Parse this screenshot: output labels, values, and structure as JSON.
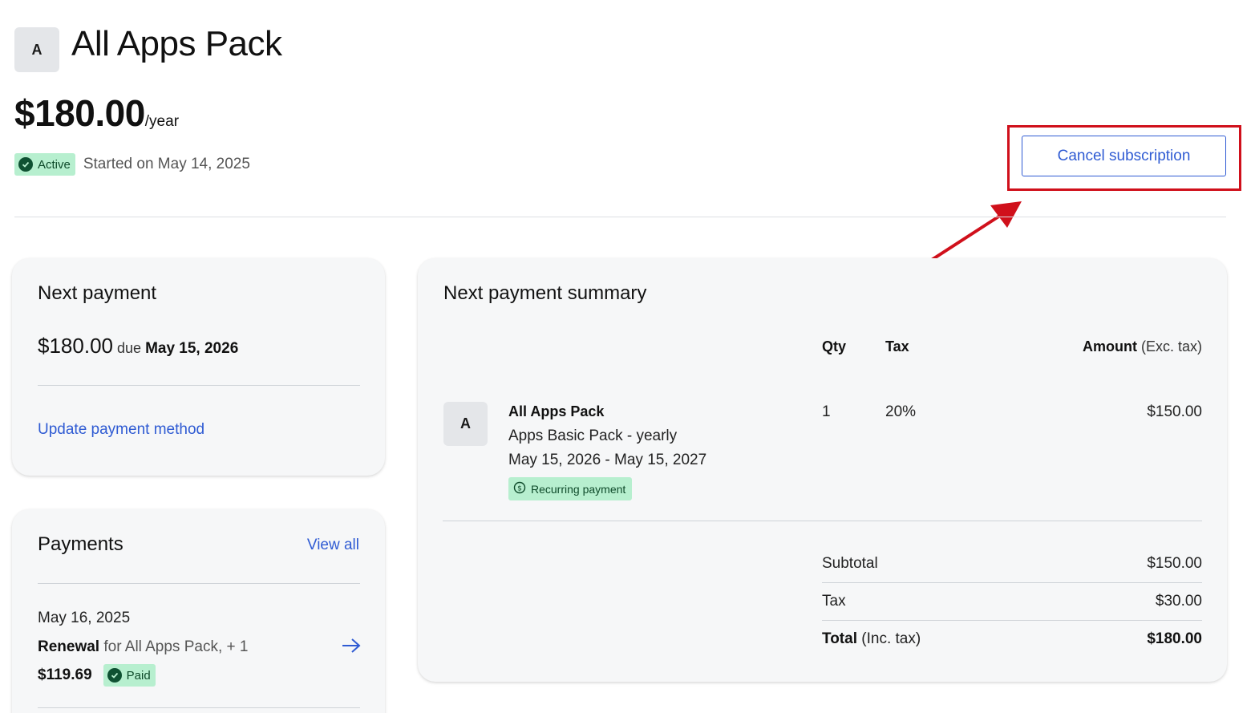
{
  "header": {
    "avatar_letter": "A",
    "title": "All Apps Pack",
    "price": "$180.00",
    "price_period": "/year",
    "status_badge": "Active",
    "started_text": "Started on May 14, 2025",
    "cancel_label": "Cancel subscription"
  },
  "next_payment": {
    "title": "Next payment",
    "amount": "$180.00",
    "due_word": "due",
    "due_date": "May 15, 2026",
    "update_link": "Update payment method"
  },
  "payments": {
    "title": "Payments",
    "view_all": "View all",
    "items": [
      {
        "date": "May 16, 2025",
        "type": "Renewal",
        "description": "for All Apps Pack, + 1",
        "amount": "$119.69",
        "status": "Paid"
      }
    ]
  },
  "summary": {
    "title": "Next payment summary",
    "columns": {
      "qty": "Qty",
      "tax": "Tax",
      "amount": "Amount",
      "amount_note": "(Exc. tax)"
    },
    "line_items": [
      {
        "avatar_letter": "A",
        "name": "All Apps Pack",
        "plan": "Apps Basic Pack - yearly",
        "period": "May 15, 2026 - May 15, 2027",
        "badge": "Recurring payment",
        "qty": "1",
        "tax": "20%",
        "amount": "$150.00"
      }
    ],
    "subtotal_label": "Subtotal",
    "subtotal_value": "$150.00",
    "tax_label": "Tax",
    "tax_value": "$30.00",
    "total_label": "Total",
    "total_note": "(Inc. tax)",
    "total_value": "$180.00"
  },
  "colors": {
    "accent_blue": "#2f5bd3",
    "badge_green_bg": "#b7efcf",
    "highlight_red": "#d0101b"
  },
  "icons": [
    "check-circle-icon",
    "arrow-right-icon",
    "dollar-circle-icon",
    "annotation-arrow-icon"
  ]
}
